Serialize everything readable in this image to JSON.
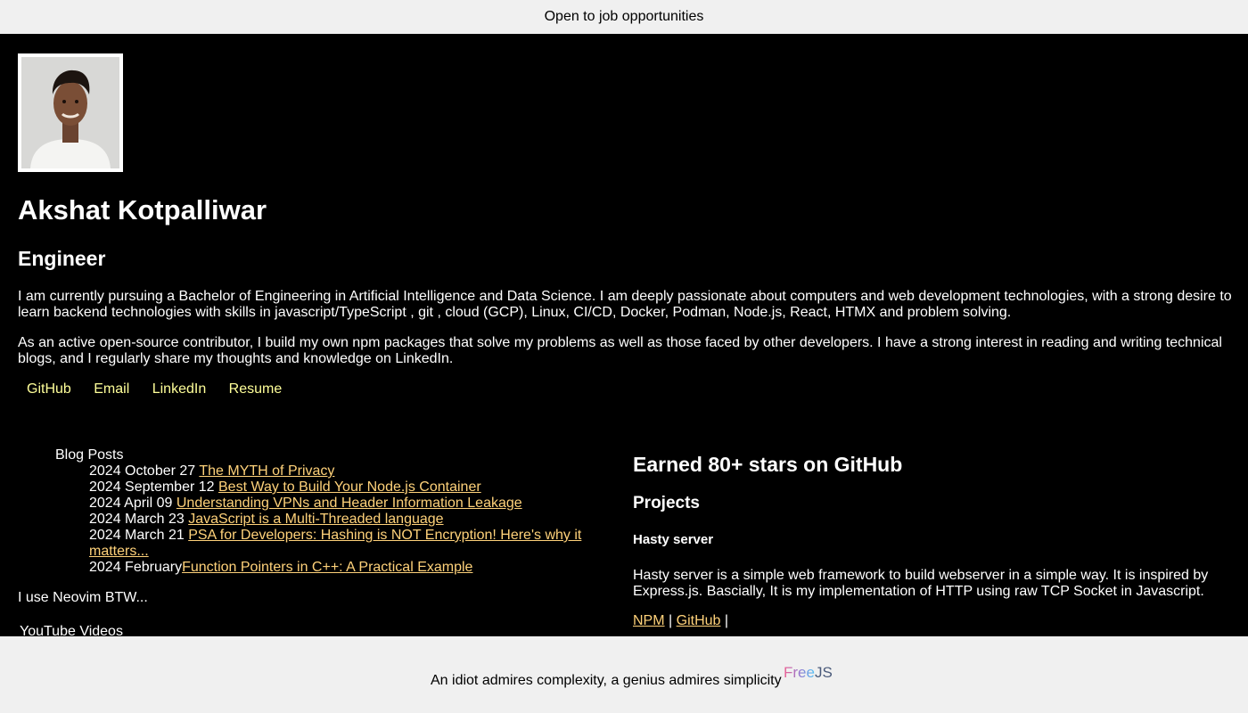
{
  "banner": {
    "text": "Open to job opportunities"
  },
  "profile": {
    "name": "Akshat Kotpalliwar",
    "role": "Engineer",
    "bio": [
      "I am currently pursuing a Bachelor of Engineering in Artificial Intelligence and Data Science. I am deeply passionate about computers and web development technologies, with a strong desire to learn backend technologies with skills in javascript/TypeScript , git , cloud (GCP), Linux, CI/CD, Docker, Podman, Node.js, React, HTMX and problem solving.",
      "As an active open-source contributor, I build my own npm packages that solve my problems as well as those faced by other developers. I have a strong interest in reading and writing technical blogs, and I regularly share my thoughts and knowledge on LinkedIn."
    ]
  },
  "social_links": [
    {
      "label": "GitHub"
    },
    {
      "label": "Email"
    },
    {
      "label": "LinkedIn"
    },
    {
      "label": "Resume"
    }
  ],
  "blog": {
    "heading": "Blog Posts",
    "posts": [
      {
        "date": "2024 October 27",
        "title": "The MYTH of Privacy"
      },
      {
        "date": "2024 September 12",
        "title": "Best Way to Build Your Node.js Container"
      },
      {
        "date": "2024 April 09",
        "title": "Understanding VPNs and Header Information Leakage"
      },
      {
        "date": "2024 March 23",
        "title": "JavaScript is a Multi-Threaded language"
      },
      {
        "date": "2024 March 21",
        "title": "PSA for Developers: Hashing is NOT Encryption! Here's why it matters..."
      },
      {
        "date": "2024 February",
        "title": "Function Pointers in C++: A Practical Example"
      }
    ]
  },
  "neovim_text": "I use Neovim BTW...",
  "youtube_heading": "YouTube Videos",
  "github_stars": "Earned 80+ stars on GitHub",
  "projects": {
    "title": "Projects",
    "items": [
      {
        "name": "Hasty server",
        "description": "Hasty server is a simple web framework to build webserver in a simple way. It is inspired by Express.js. Bascially, It is my implementation of HTTP using raw TCP Socket in Javascript.",
        "link_npm": "NPM",
        "link_github": "GitHub",
        "separator": "|"
      }
    ]
  },
  "footer": {
    "quote": "An idiot admires complexity, a genius admires simplicity",
    "logo_free": "Free",
    "logo_js": "JS"
  }
}
